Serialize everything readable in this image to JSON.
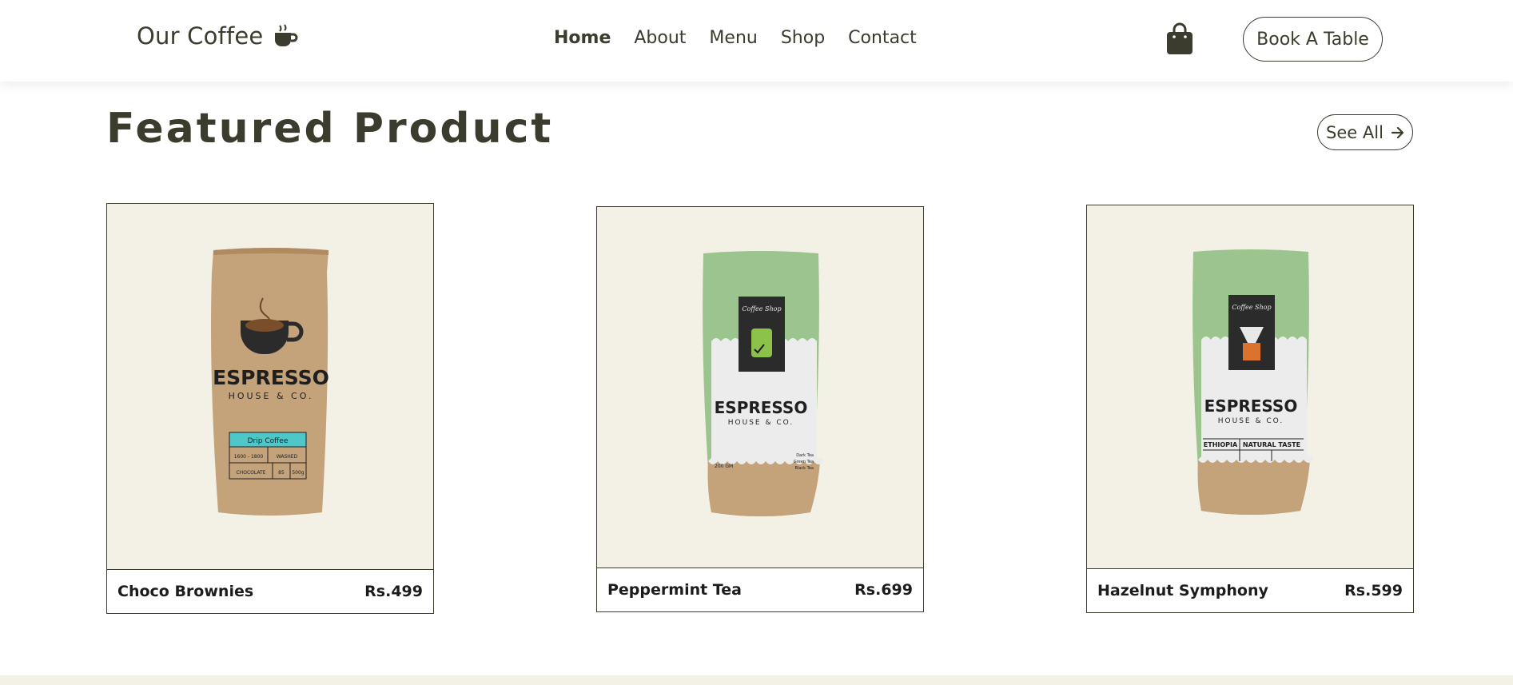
{
  "header": {
    "logo_text": "Our Coffee",
    "logo_icon": "coffee-cup-icon",
    "nav": [
      {
        "label": "Home",
        "active": true
      },
      {
        "label": "About",
        "active": false
      },
      {
        "label": "Menu",
        "active": false
      },
      {
        "label": "Shop",
        "active": false
      },
      {
        "label": "Contact",
        "active": false
      }
    ],
    "cart_icon": "shopping-bag-icon",
    "cta_label": "Book A Table"
  },
  "featured": {
    "title": "Featured Product",
    "see_all_label": "See All",
    "see_all_icon": "arrow-right-icon",
    "products": [
      {
        "name": "Choco Brownies",
        "price": "Rs.499",
        "bag_brand": "ESPRESSO",
        "bag_sub": "HOUSE & CO.",
        "bag_label_title": "Drip Coffee",
        "bag_label_cells": [
          "1600 - 1800",
          "WASHED",
          "CHOCOLATE",
          "85",
          "500g"
        ]
      },
      {
        "name": "Peppermint Tea",
        "price": "Rs.699",
        "bag_brand": "ESPRESSO",
        "bag_sub": "HOUSE & CO.",
        "bag_badge": "Coffee Shop",
        "bag_weight": "200 GM",
        "bag_notes": [
          "Dark Tea",
          "Green Tea",
          "Black Tea"
        ]
      },
      {
        "name": "Hazelnut Symphony",
        "price": "Rs.599",
        "bag_brand": "ESPRESSO",
        "bag_sub": "HOUSE & CO.",
        "bag_badge": "Coffee Shop",
        "bag_origin": "ETHIOPIA",
        "bag_taste": "NATURAL TASTE"
      }
    ]
  },
  "colors": {
    "primary": "#3b3b2e",
    "card_bg": "#f3f0e6",
    "kraft": "#c4a27a",
    "green": "#9cc48e"
  }
}
